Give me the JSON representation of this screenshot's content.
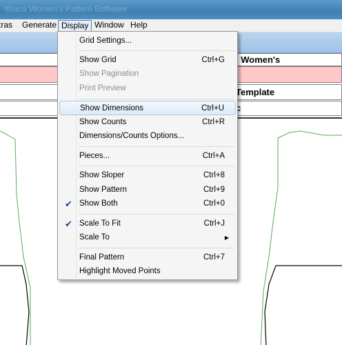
{
  "window": {
    "title": "Ithaca Women's Pattern Software"
  },
  "menubar": {
    "extras": "tras",
    "generate": "Generate",
    "display": "Display",
    "window": "Window",
    "help": "Help"
  },
  "rows": {
    "row1": "l Women's",
    "row3": "Template",
    "row4": "c"
  },
  "display_menu": {
    "items": [
      {
        "label": "Grid Settings...",
        "shortcut": ""
      },
      {
        "label": "Show Grid",
        "shortcut": "Ctrl+G"
      },
      {
        "label": "Show Pagination",
        "shortcut": ""
      },
      {
        "label": "Print Preview",
        "shortcut": ""
      },
      {
        "label": "Show Dimensions",
        "shortcut": "Ctrl+U"
      },
      {
        "label": "Show Counts",
        "shortcut": "Ctrl+R"
      },
      {
        "label": "Dimensions/Counts Options...",
        "shortcut": ""
      },
      {
        "label": "Pieces...",
        "shortcut": "Ctrl+A"
      },
      {
        "label": "Show Sloper",
        "shortcut": "Ctrl+8"
      },
      {
        "label": "Show Pattern",
        "shortcut": "Ctrl+9"
      },
      {
        "label": "Show Both",
        "shortcut": "Ctrl+0"
      },
      {
        "label": "Scale To Fit",
        "shortcut": "Ctrl+J"
      },
      {
        "label": "Scale To",
        "shortcut": ""
      },
      {
        "label": "Final Pattern",
        "shortcut": "Ctrl+7"
      },
      {
        "label": "Highlight Moved Points",
        "shortcut": ""
      }
    ]
  },
  "colors": {
    "highlight_row": "#ffc7c7",
    "sloper_line": "#5aa85a",
    "pattern_line": "#000000"
  }
}
